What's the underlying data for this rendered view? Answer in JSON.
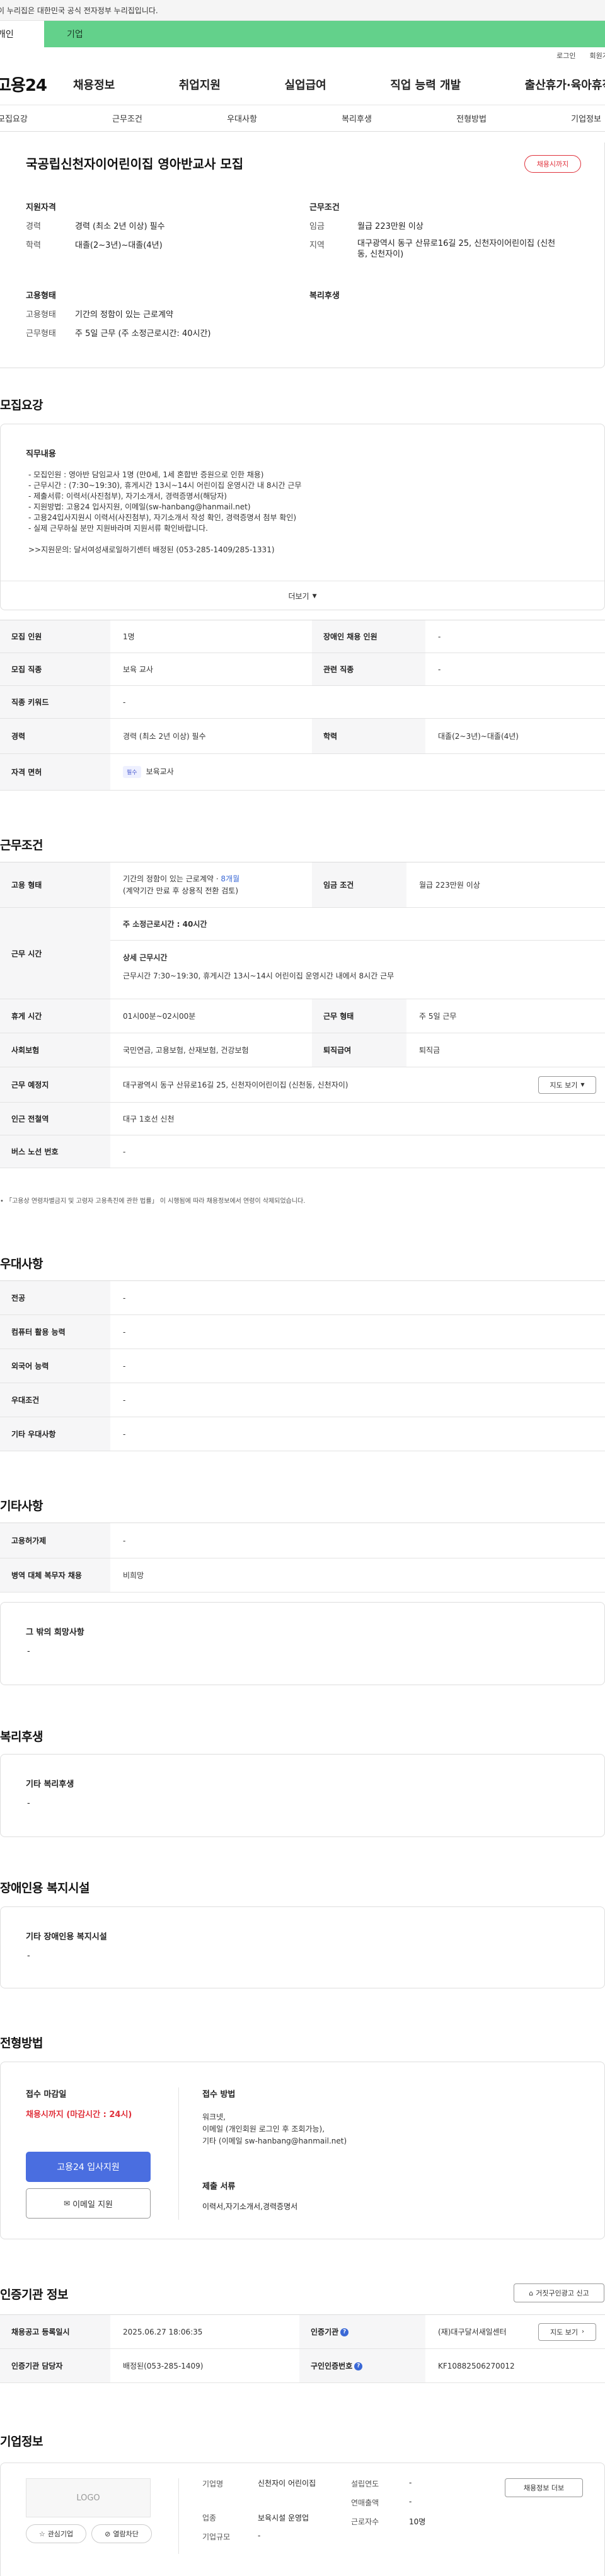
{
  "gov_banner": "이 누리집은 대한민국 공식 전자정부 누리집입니다.",
  "category": {
    "left": "개인",
    "right": "기업"
  },
  "util": {
    "login": "로그인",
    "join": "회원가입"
  },
  "logo": "고용24",
  "gnb": [
    "채용정보",
    "취업지원",
    "실업급여",
    "직업 능력 개발",
    "출산휴가·육아휴직"
  ],
  "tabs": [
    "모집요강",
    "근무조건",
    "우대사항",
    "복리후생",
    "전형방법",
    "기업정보"
  ],
  "summary": {
    "title": "국공립신천자이어린이집 영아반교사 모집",
    "badge": "채용시까지",
    "qual_title": "지원자격",
    "qual_rows": [
      {
        "k": "경력",
        "v": "경력 (최소 2년 이상) 필수"
      },
      {
        "k": "학력",
        "v": "대졸(2~3년)~대졸(4년)"
      }
    ],
    "cond_title": "근무조건",
    "cond_rows": [
      {
        "k": "임금",
        "v": "월급 223만원 이상"
      },
      {
        "k": "지역",
        "v": "대구광역시 동구 산뮤로16길 25, 신천자이어린이집 (신천동, 신천자이)"
      }
    ],
    "emp_title": "고용형태",
    "emp_rows": [
      {
        "k": "고용형태",
        "v": "기간의 정함이 있는 근로계약"
      },
      {
        "k": "근무형태",
        "v": "주 5일 근무 (주 소정근로시간: 40시간)"
      }
    ],
    "welfare_title": "복리후생"
  },
  "recruit": {
    "title": "모집요강",
    "job_title": "직무내용",
    "job_lines": [
      "- 모집인원 : 영아반 담임교사 1명 (만0세, 1세 혼합반 증원으로 인한 채용)",
      "- 근무시간 : (7:30~19:30), 휴게시간 13시~14시 어린이집 운영시간 내 8시간 근무",
      "- 제출서류: 이력서(사진첨부), 자기소개서, 경력증명서(해당자)",
      "- 지원방법: 고용24 입사지원, 이메일(sw-hanbang@hanmail.net)",
      "- 고용24입사지원시 이력서(사진첨부), 자기소개서 작성 확인, 경력증명서 첨부 확인)",
      "- 실제 근무하실 분만 지원바라며 지원서류 확인바랍니다.",
      "",
      ">>지원문의: 달서여성새로일하기센터 배정된 (053-285-1409/285-1331)"
    ],
    "more": "더보기",
    "rows": [
      {
        "k1": "모집 인원",
        "v1": "1명",
        "k2": "장애인 채용 인원",
        "v2": "-"
      },
      {
        "k1": "모집 직종",
        "v1": "보육 교사",
        "k2": "관련 직종",
        "v2": "-"
      },
      {
        "k1": "직종 키워드",
        "v1": "-"
      },
      {
        "k1": "경력",
        "v1": "경력 (최소 2년 이상) 필수",
        "k2": "학력",
        "v2": "대졸(2~3년)~대졸(4년)"
      },
      {
        "k1": "자격 면허",
        "tag": "필수",
        "v1": "보육교사"
      }
    ]
  },
  "work": {
    "title": "근무조건",
    "emp_k": "고용 형태",
    "emp_v": "기간의 정함이 있는 근로계약",
    "emp_months": "8개월",
    "emp_sep": " · ",
    "emp_sub": "(계약기간 만료 후 상용직 전환 검토)",
    "wage_k": "임금 조건",
    "wage_v": "월급 223만원 이상",
    "time_k": "근무 시간",
    "time_std_k": "주 소정근로시간 :",
    "time_std_v": "40시간",
    "time_detail_k": "상세 근무시간",
    "time_detail_v": "근무시간 7:30~19:30, 휴게시간 13시~14시 어린이집 운영시간 내에서 8시간 근무",
    "break_k": "휴게 시간",
    "break_v": "01시00분~02시00분",
    "form_k": "근무 형태",
    "form_v": "주 5일 근무",
    "ins_k": "사회보험",
    "ins_v": "국민연금, 고용보험, 산재보험, 건강보험",
    "sev_k": "퇴직급여",
    "sev_v": "퇴직금",
    "place_k": "근무 예정지",
    "place_v": "대구광역시 동구 산뮤로16길 25, 신천자이어린이집 (신천동, 신천자이)",
    "map_btn": "지도 보기",
    "station_k": "인근 전철역",
    "station_v": "대구 1호선 신천",
    "bus_k": "버스 노선 번호",
    "bus_v": "-",
    "note": "「고용상 연령차별금지 및 고령자 고용촉진에 관한 법률」 이 시행됨에 따라 채용정보에서 연령이 삭제되었습니다."
  },
  "pref": {
    "title": "우대사항",
    "rows": [
      {
        "k": "전공",
        "v": "-"
      },
      {
        "k": "컴퓨터 활용 능력",
        "v": "-"
      },
      {
        "k": "외국어 능력",
        "v": "-"
      },
      {
        "k": "우대조건",
        "v": "-"
      },
      {
        "k": "기타 우대사항",
        "v": "-"
      }
    ]
  },
  "etc": {
    "title": "기타사항",
    "rows": [
      {
        "k": "고용허가제",
        "v": "-"
      },
      {
        "k": "병역 대체 복무자 채용",
        "v": "비희망"
      }
    ],
    "wish_k": "그 밖의 희망사항",
    "wish_v": "-"
  },
  "welfare": {
    "title": "복리후생",
    "k": "기타 복리후생",
    "v": "-"
  },
  "disabled": {
    "title": "장애인용 복지시설",
    "k": "기타 장애인용 복지시설",
    "v": "-"
  },
  "process": {
    "title": "전형방법",
    "deadline_k": "접수 마감일",
    "deadline_v": "채용시까지 (마감시간 : 24시)",
    "apply_btn": "고용24 입사지원",
    "email_btn": "이메일 지원",
    "method_k": "접수 방법",
    "method_lines": [
      "워크넷,",
      "이메일 (개인회원 로그인 후 조회가능),",
      "기타 (이메일 sw-hanbang@hanmail.net)"
    ],
    "docs_k": "제출 서류",
    "docs_v": "이력서,자기소개서,경력증명서"
  },
  "cert": {
    "title": "인증기관 정보",
    "report_btn": "거짓구인광고 신고",
    "rows": [
      {
        "k1": "채용공고 등록일시",
        "v1": "2025.06.27 18:06:35",
        "k2": "인증기관",
        "v2": "(재)대구달서새일센터",
        "btn": "지도 보기"
      },
      {
        "k1": "인증기관 담당자",
        "v1": "배정된(053-285-1409)",
        "k2": "구인인증번호",
        "v2": "KF10882506270012"
      }
    ]
  },
  "company": {
    "title": "기업정보",
    "logo_text": "LOGO",
    "fav": "관심기업",
    "block": "열람차단",
    "list_btn": "채용정보 더보",
    "rows": [
      {
        "k": "기업명",
        "v": "신천자이 어린이집"
      },
      {
        "k": "업종",
        "v": "보육시설 운영업"
      },
      {
        "k": "기업규모",
        "v": "-"
      }
    ],
    "rows2": [
      {
        "k": "설립연도",
        "v": "-"
      },
      {
        "k": "연매출액",
        "v": "-"
      },
      {
        "k": "근로자수",
        "v": "10명"
      }
    ]
  },
  "colors": {
    "accent": "#63d18b",
    "primary_btn": "#4a6ee0",
    "red": "#e0323c",
    "tag_bg": "#eef0ff"
  }
}
